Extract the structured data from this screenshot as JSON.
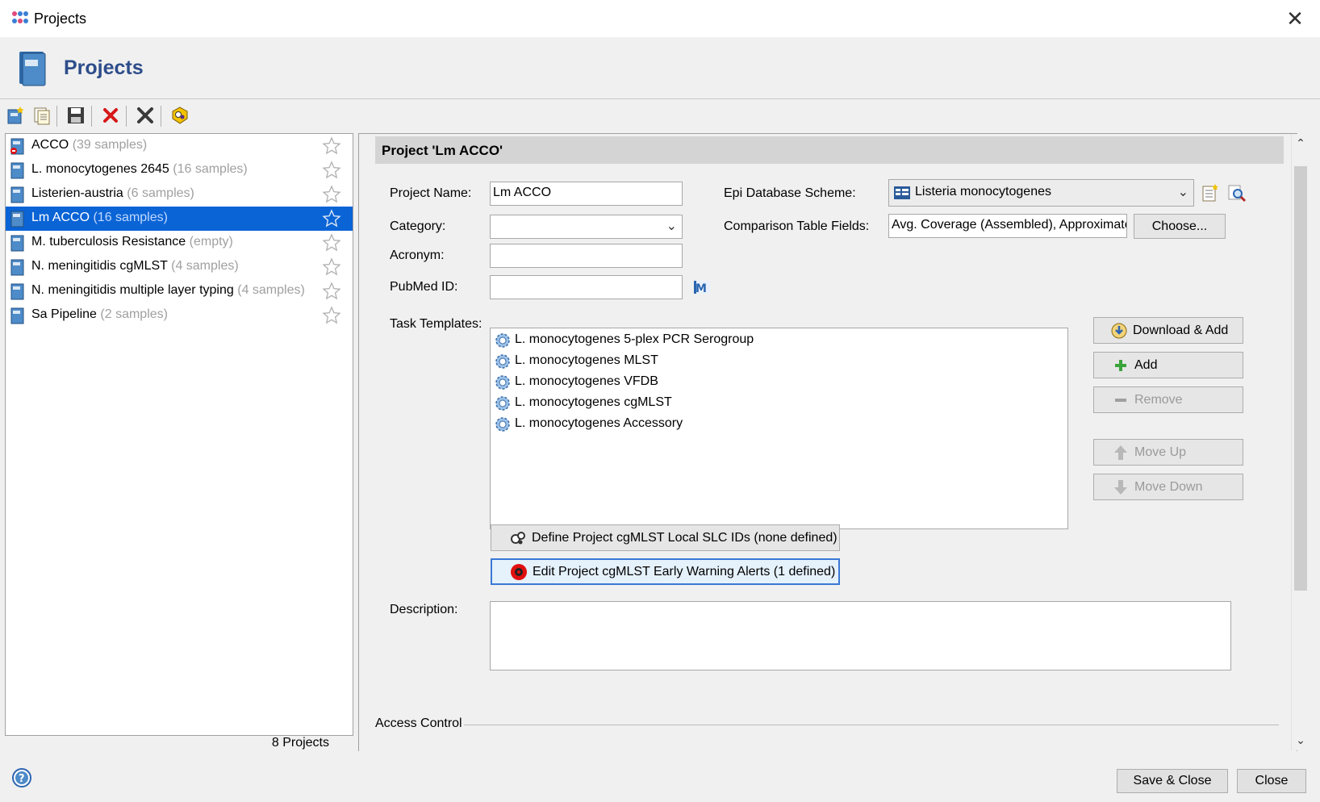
{
  "window": {
    "title": "Projects",
    "close_glyph": "✕"
  },
  "header": {
    "title": "Projects"
  },
  "toolbar": {
    "buttons": [
      {
        "name": "new-project-icon"
      },
      {
        "name": "copy-project-icon"
      },
      {
        "name": "save-icon"
      },
      {
        "name": "delete-icon"
      },
      {
        "name": "tools-icon"
      },
      {
        "name": "cgmlst-icon"
      }
    ]
  },
  "projects": {
    "items": [
      {
        "name": "ACCO",
        "count": "(39 samples)",
        "selected": false
      },
      {
        "name": "L. monocytogenes 2645",
        "count": "(16 samples)",
        "selected": false
      },
      {
        "name": "Listerien-austria",
        "count": "(6 samples)",
        "selected": false
      },
      {
        "name": "Lm ACCO",
        "count": "(16 samples)",
        "selected": true
      },
      {
        "name": "M. tuberculosis Resistance",
        "count": "(empty)",
        "selected": false
      },
      {
        "name": "N. meningitidis cgMLST",
        "count": "(4 samples)",
        "selected": false
      },
      {
        "name": "N. meningitidis multiple layer typing",
        "count": "(4 samples)",
        "selected": false
      },
      {
        "name": "Sa Pipeline",
        "count": "(2 samples)",
        "selected": false
      }
    ],
    "footer": "8 Projects"
  },
  "detail": {
    "section_title": "Project 'Lm ACCO'",
    "project_name_label": "Project Name:",
    "project_name_value": "Lm ACCO",
    "category_label": "Category:",
    "category_value": "",
    "acronym_label": "Acronym:",
    "acronym_value": "",
    "pubmed_label": "PubMed ID:",
    "pubmed_value": "",
    "epi_label": "Epi Database Scheme:",
    "epi_value": "Listeria monocytogenes",
    "comparison_label": "Comparison Table Fields:",
    "comparison_value": "Avg. Coverage (Assembled), Approximate",
    "choose_label": "Choose...",
    "task_templates_label": "Task Templates:",
    "task_templates": [
      "L. monocytogenes 5-plex PCR Serogroup",
      "L. monocytogenes MLST",
      "L. monocytogenes VFDB",
      "L. monocytogenes cgMLST",
      "L. monocytogenes Accessory"
    ],
    "download_add_label": "Download & Add",
    "add_label": "Add",
    "remove_label": "Remove",
    "move_up_label": "Move Up",
    "move_down_label": "Move Down",
    "define_slc_label": "Define Project cgMLST Local SLC IDs (none defined)",
    "edit_alerts_label": "Edit Project cgMLST Early Warning Alerts (1 defined)",
    "description_label": "Description:",
    "description_value": "",
    "access_control_label": "Access Control"
  },
  "footer": {
    "save_close_label": "Save & Close",
    "close_label": "Close"
  },
  "colors": {
    "selection": "#0a64d6",
    "heading": "#2d4d8a",
    "alert_red": "#e01010"
  }
}
